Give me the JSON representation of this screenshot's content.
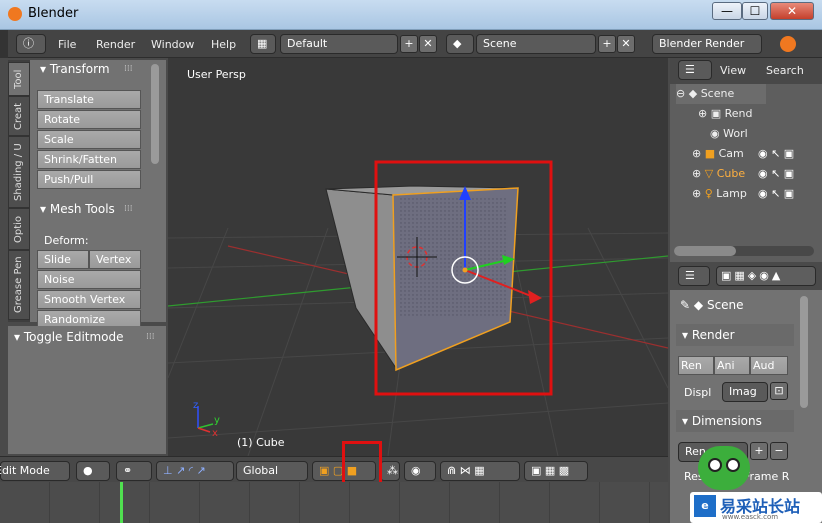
{
  "window": {
    "title": "Blender",
    "minimize": "—",
    "maximize": "☐",
    "close": "✕"
  },
  "infobar": {
    "menus": [
      "File",
      "Render",
      "Window",
      "Help"
    ],
    "layout": "Default",
    "scene": "Scene",
    "engine": "Blender Render",
    "add_glyph": "+",
    "remove_glyph": "✕"
  },
  "toolshelf": {
    "tabs": [
      "Tool",
      "Creat",
      "Shading / U",
      "Optio",
      "Grease Pen"
    ],
    "transform_header": "Transform",
    "transform_buttons": [
      "Translate",
      "Rotate",
      "Scale",
      "Shrink/Fatten",
      "Push/Pull"
    ],
    "mesh_tools_header": "Mesh Tools",
    "deform_label": "Deform:",
    "slide_edge": "Slide Ed",
    "vertex": "Vertex",
    "mesh_buttons": [
      "Noise",
      "Smooth Vertex",
      "Randomize"
    ],
    "toggle_editmode": "Toggle Editmode"
  },
  "viewport": {
    "view_label": "User Persp",
    "object_label": "(1) Cube",
    "axis_x": "x",
    "axis_y": "y",
    "axis_z": "z"
  },
  "outliner": {
    "view_menu": "View",
    "search_menu": "Search",
    "rows": [
      "Scene",
      "Rend",
      "Worl",
      "Cam",
      "Cube",
      "Lamp"
    ]
  },
  "properties": {
    "scene_label": "Scene",
    "render_header": "Render",
    "render_buttons": [
      "Ren",
      "Ani",
      "Aud"
    ],
    "display_label": "Displ",
    "display_value": "Imag",
    "dimensions_header": "Dimensions",
    "preset_value": "Ren",
    "resolution_label": "Res",
    "frame_label": "Frame R"
  },
  "view3d_header": {
    "mode": "Edit Mode",
    "orientation": "Global"
  },
  "watermark": {
    "text": "易采站长站",
    "subtext": "www.easck.com"
  },
  "colors": {
    "highlight_red": "#e01010",
    "selection_orange": "#f0a020",
    "axis_blue": "#2040ff",
    "axis_red": "#e02020",
    "axis_green": "#20d020"
  }
}
